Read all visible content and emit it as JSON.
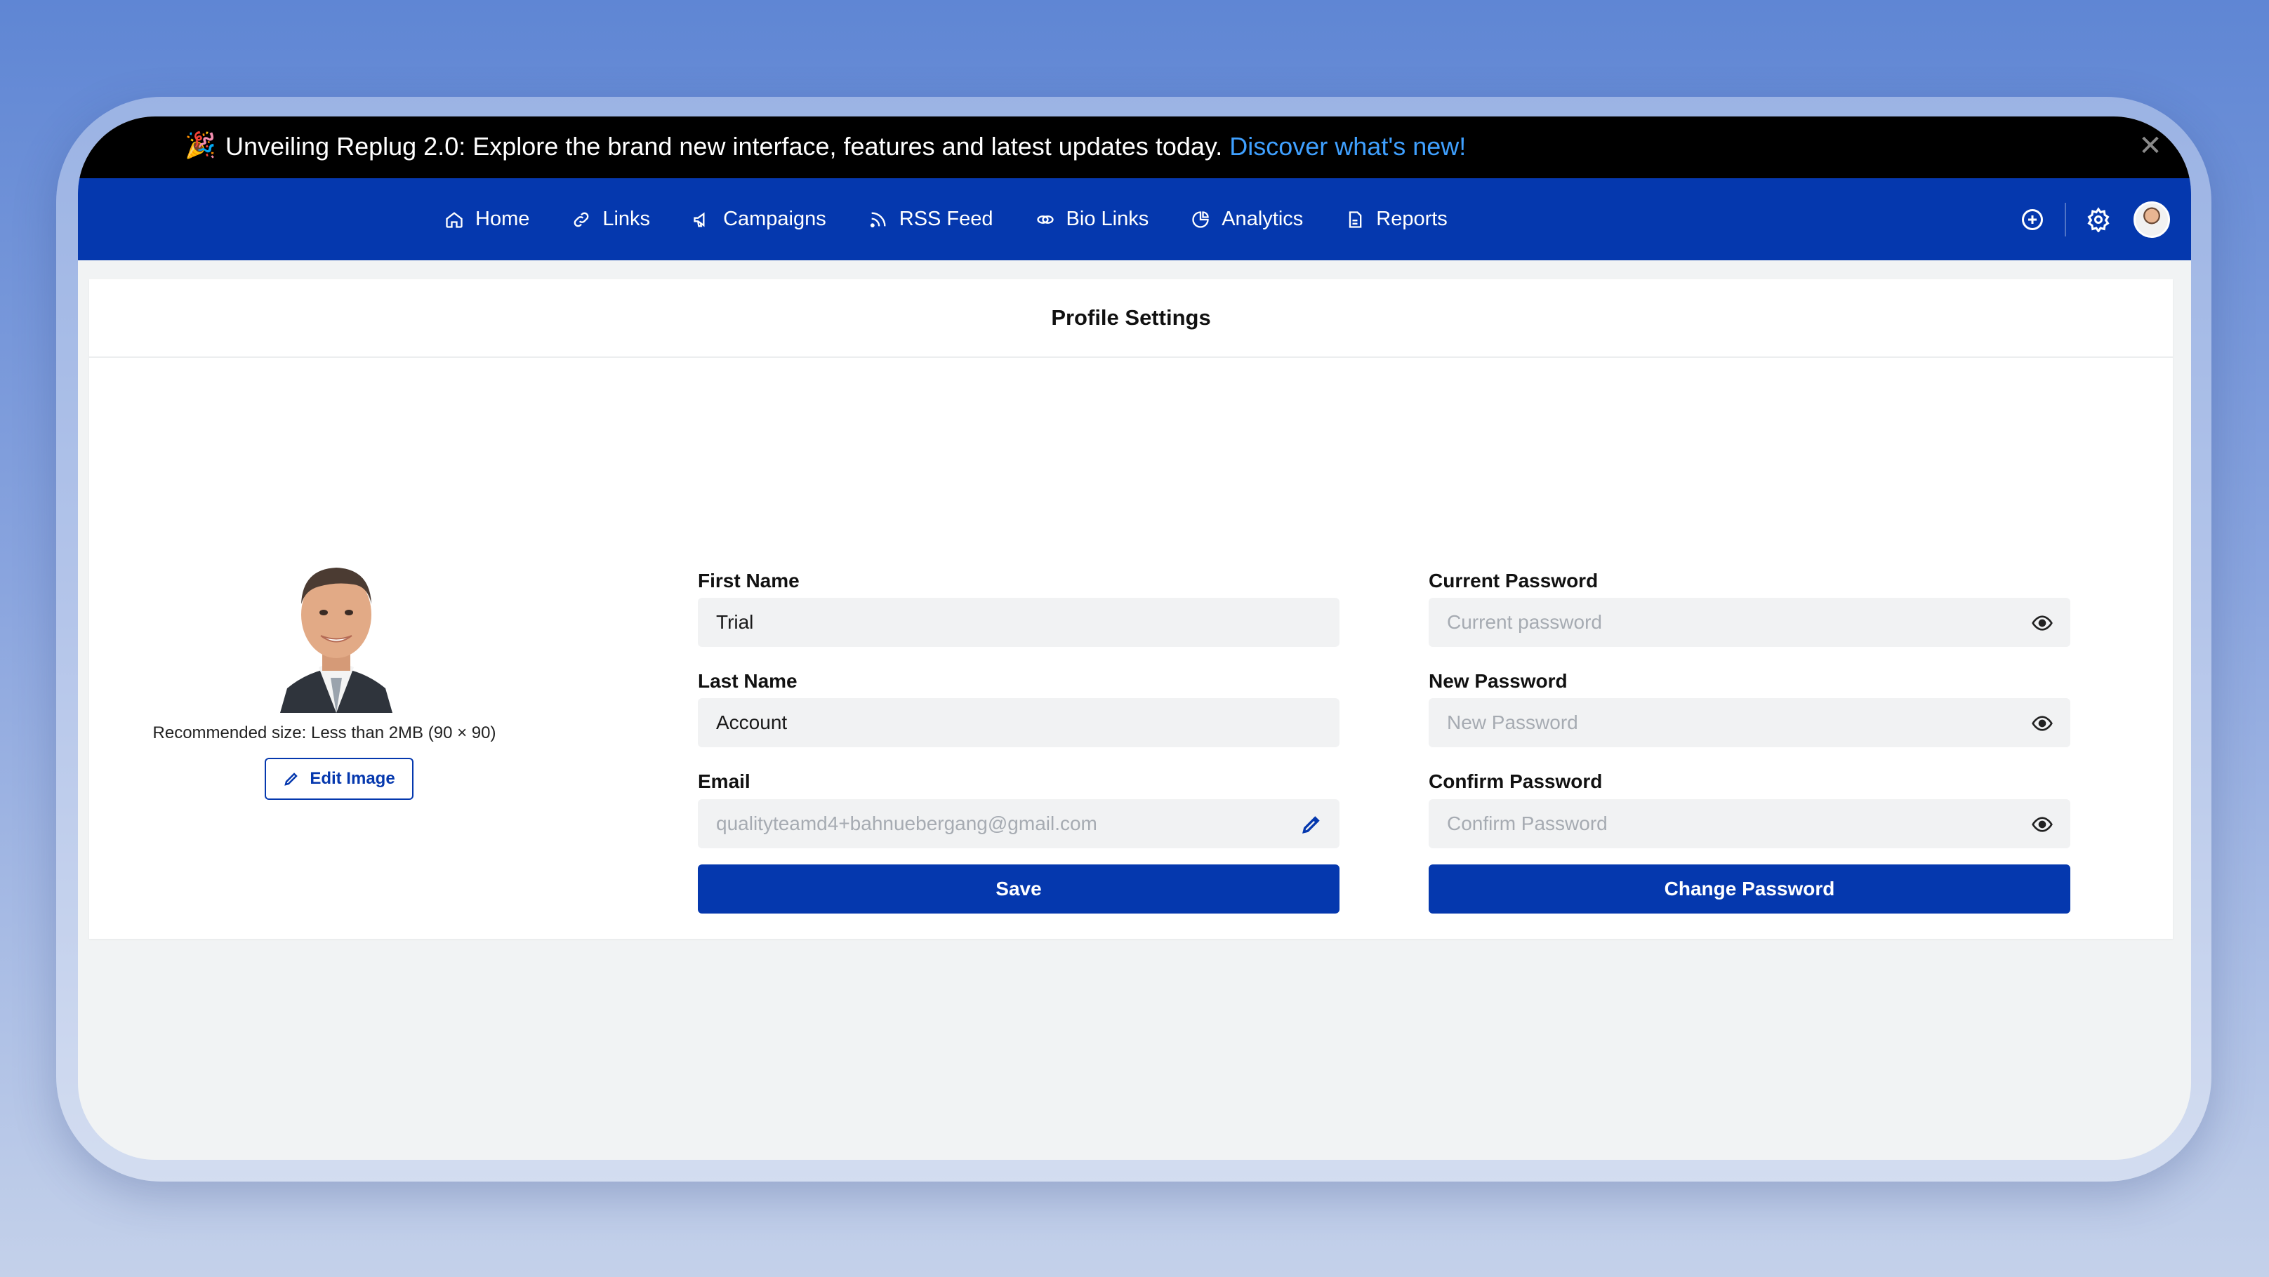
{
  "announcement": {
    "emoji": "🎉",
    "text": "Unveiling Replug 2.0: Explore the brand new interface, features and latest updates today.",
    "link": "Discover what's new!",
    "close_icon": "close-icon"
  },
  "nav": {
    "items": [
      {
        "label": "Home",
        "icon": "home-icon"
      },
      {
        "label": "Links",
        "icon": "link-icon"
      },
      {
        "label": "Campaigns",
        "icon": "megaphone-icon"
      },
      {
        "label": "RSS Feed",
        "icon": "rss-icon"
      },
      {
        "label": "Bio Links",
        "icon": "bio-link-icon"
      },
      {
        "label": "Analytics",
        "icon": "pie-chart-icon"
      },
      {
        "label": "Reports",
        "icon": "report-icon"
      }
    ],
    "right_icons": [
      "plus-circle-icon",
      "gear-icon",
      "user-avatar"
    ]
  },
  "card": {
    "title": "Profile Settings",
    "recommended_size": "Recommended size: Less than 2MB (90 × 90)",
    "edit_image_label": "Edit Image"
  },
  "profile_form": {
    "first_name_label": "First Name",
    "first_name_value": "Trial",
    "last_name_label": "Last Name",
    "last_name_value": "Account",
    "email_label": "Email",
    "email_value": "qualityteamd4+bahnuebergang@gmail.com",
    "save_label": "Save"
  },
  "password_form": {
    "current_label": "Current Password",
    "current_placeholder": "Current password",
    "new_label": "New Password",
    "new_placeholder": "New Password",
    "confirm_label": "Confirm Password",
    "confirm_placeholder": "Confirm Password",
    "change_label": "Change Password"
  },
  "colors": {
    "brand": "#0538ae",
    "announce_link": "#3fa0ff",
    "field_bg": "#f1f2f3"
  }
}
